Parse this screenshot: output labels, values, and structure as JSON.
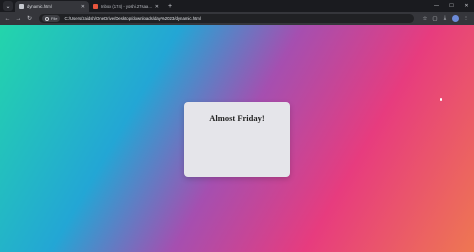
{
  "tabs": [
    {
      "title": "dynamic.html",
      "active": true,
      "icon": "file-icon"
    },
    {
      "title": "Inbox (174) - yoshi.27saad@gm...",
      "active": false,
      "icon": "mail-icon"
    }
  ],
  "toolbar": {
    "file_chip_label": "File",
    "url": "C:/Users/zaidsh/OneDrive/Desktop/downloads/day%2023/dynamic.html"
  },
  "page": {
    "card_title": "Almost Friday!"
  },
  "colors": {
    "gradient": [
      "#23d5ab",
      "#23a6d5",
      "#a54fb0",
      "#e73c7e",
      "#ee7752"
    ],
    "card_bg": "#e5e5ea"
  }
}
